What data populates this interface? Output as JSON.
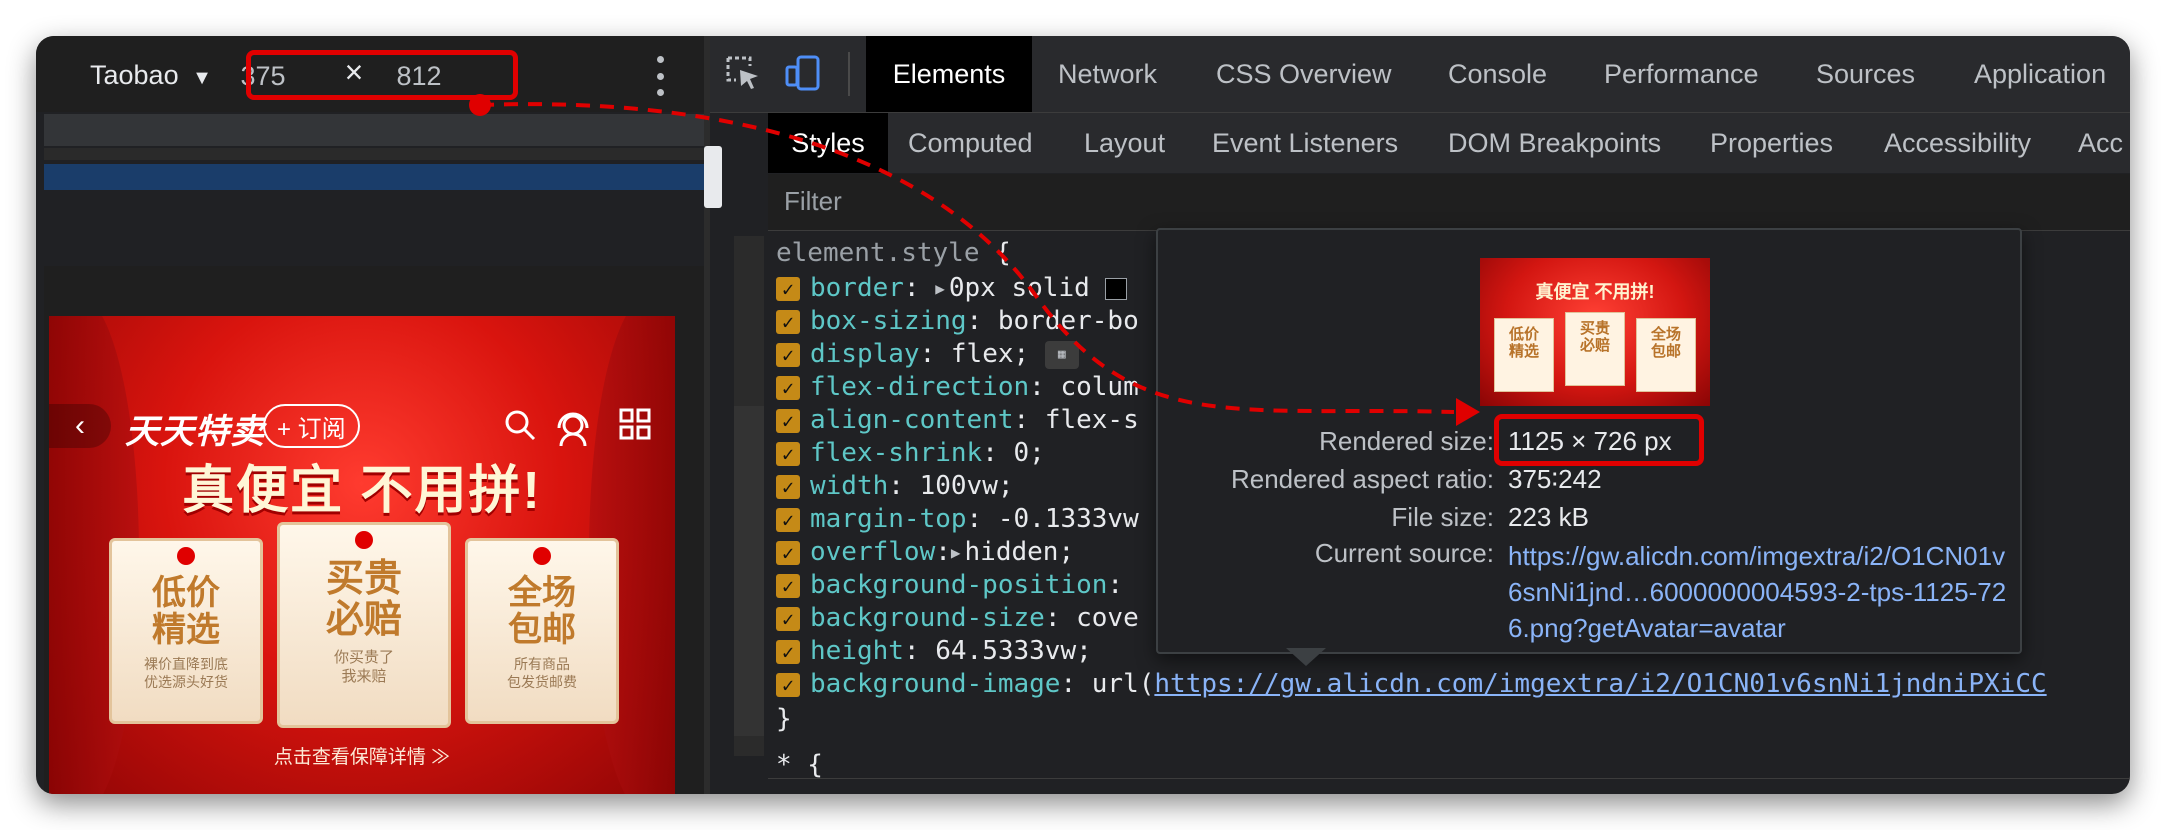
{
  "device": {
    "name": "Taobao",
    "dropdown_icon": "▼",
    "width": "375",
    "height": "812",
    "times": "×"
  },
  "banner": {
    "brand": "天天特卖",
    "subscribe": "+ 订阅",
    "headline": "真便宜 不用拼!",
    "cards": [
      {
        "title": "低价\n精选",
        "sub": "裸价直降到底\n优选源头好货"
      },
      {
        "title": "买贵\n必赔",
        "sub": "你买贵了\n我来赔"
      },
      {
        "title": "全场\n包邮",
        "sub": "所有商品\n包发货邮费"
      }
    ],
    "footer": "点击查看保障详情 ≫"
  },
  "devtools": {
    "tabs": [
      "Elements",
      "Network",
      "CSS Overview",
      "Console",
      "Performance",
      "Sources",
      "Application"
    ],
    "active_tab": "Elements",
    "subtabs": [
      "Styles",
      "Computed",
      "Layout",
      "Event Listeners",
      "DOM Breakpoints",
      "Properties",
      "Accessibility",
      "Acc"
    ],
    "active_subtab": "Styles",
    "filter_placeholder": "Filter",
    "selector": "element.style",
    "open_brace": "{",
    "close_brace": "}",
    "next_selector": "* {",
    "rules": [
      {
        "prop": "border",
        "colon": ":",
        "value": "0px solid",
        "has_toggle": true,
        "swatch": true
      },
      {
        "prop": "box-sizing",
        "colon": ":",
        "value": "border-bo"
      },
      {
        "prop": "display",
        "colon": ":",
        "value": "flex;",
        "badge": true
      },
      {
        "prop": "flex-direction",
        "colon": ":",
        "value": "colum"
      },
      {
        "prop": "align-content",
        "colon": ":",
        "value": "flex-s"
      },
      {
        "prop": "flex-shrink",
        "colon": ":",
        "value": "0;"
      },
      {
        "prop": "width",
        "colon": ":",
        "value": "100vw;"
      },
      {
        "prop": "margin-top",
        "colon": ":",
        "value": "-0.1333vw"
      },
      {
        "prop": "overflow",
        "colon": ":",
        "value": "hidden;",
        "has_toggle": true
      },
      {
        "prop": "background-position",
        "colon": ":",
        "value": ""
      },
      {
        "prop": "background-size",
        "colon": ":",
        "value": "cove"
      },
      {
        "prop": "height",
        "colon": ":",
        "value": "64.5333vw;"
      },
      {
        "prop": "background-image",
        "colon": ":",
        "value": "url(",
        "link": "https://gw.alicdn.com/imgextra/i2/O1CN01v6snNi1jndniPXiCC"
      }
    ]
  },
  "tooltip": {
    "rendered_size_label": "Rendered size:",
    "rendered_size": "1125 × 726 px",
    "aspect_label": "Rendered aspect ratio:",
    "aspect": "375∶242",
    "file_size_label": "File size:",
    "file_size": "223 kB",
    "source_label": "Current source:",
    "source_lines": [
      "https://gw.alicdn.com/imgextra/i2/O1CN01v",
      "6snNi1jnd…6000000004593-2-tps-1125-72",
      "6.png?getAvatar=avatar"
    ],
    "thumb_headline": "真便宜 不用拼!",
    "thumb_cards": [
      "低价\n精选",
      "买贵\n必赔",
      "全场\n包邮"
    ]
  },
  "colors": {
    "highlight": "#e00000",
    "css_property": "#5ec7c7",
    "link": "#8ab4f8",
    "checkbox": "#c58a17"
  }
}
